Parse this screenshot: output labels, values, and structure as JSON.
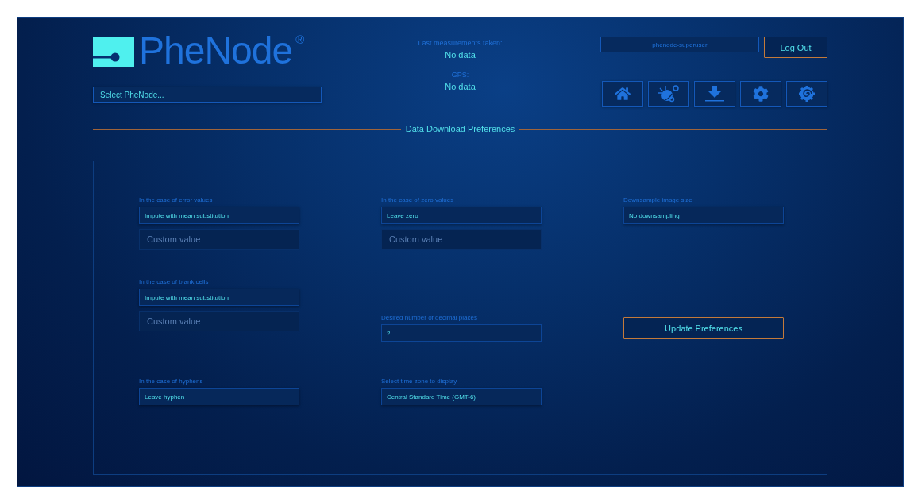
{
  "logo": {
    "name": "PheNode",
    "mark": "®"
  },
  "node_select": {
    "value": "Select PheNode..."
  },
  "status": [
    {
      "label": "Last measurements taken:",
      "value": "No data"
    },
    {
      "label": "GPS:",
      "value": "No data"
    }
  ],
  "user": {
    "name": "phenode-superuser"
  },
  "logout": {
    "label": "Log Out"
  },
  "nav": [
    {
      "kind": "home"
    },
    {
      "kind": "weather"
    },
    {
      "kind": "download"
    },
    {
      "kind": "settings"
    },
    {
      "kind": "spiral"
    }
  ],
  "section_title": "Data Download Preferences",
  "rows": [
    [
      {
        "kind": "select",
        "label": "In the case of error values",
        "value": "Impute with mean substitution",
        "custom_placeholder": "Custom value"
      },
      {
        "kind": "select",
        "label": "In the case of zero values",
        "value": "Leave zero",
        "custom_placeholder": "Custom value"
      },
      {
        "kind": "select",
        "label": "Downsample image size",
        "value": "No downsampling"
      }
    ],
    [
      {
        "kind": "select",
        "label": "In the case of blank cells",
        "value": "Impute with mean substitution",
        "custom_placeholder": "Custom value"
      },
      {
        "kind": "input",
        "label": "Desired number of decimal places",
        "value": "2"
      },
      {
        "kind": "button",
        "label": "Update Preferences"
      }
    ],
    [
      {
        "kind": "select",
        "label": "In the case of hyphens",
        "value": "Leave hyphen"
      },
      {
        "kind": "select",
        "label": "Select time zone to display",
        "value": "Central Standard Time (GMT-6)"
      }
    ]
  ]
}
